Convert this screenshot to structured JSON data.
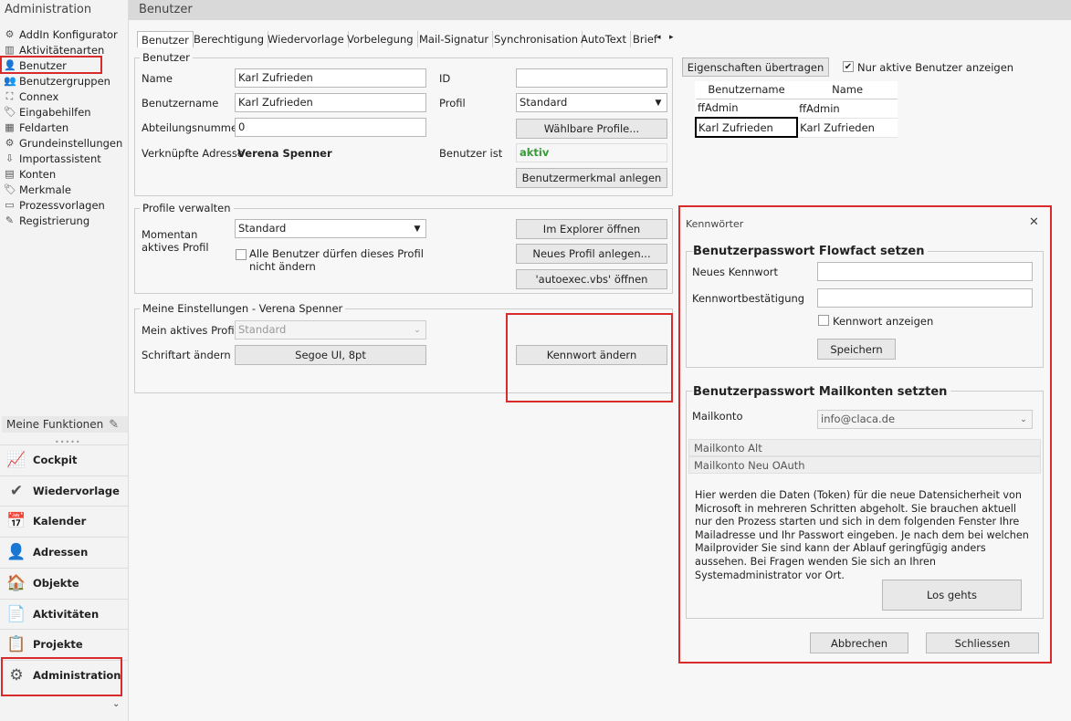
{
  "sidebar": {
    "title": "Administration",
    "tree": [
      {
        "label": "AddIn Konfigurator",
        "icon": "gears-icon"
      },
      {
        "label": "Aktivitätenarten",
        "icon": "chart-icon"
      },
      {
        "label": "Benutzer",
        "icon": "user-icon"
      },
      {
        "label": "Benutzergruppen",
        "icon": "users-icon"
      },
      {
        "label": "Connex",
        "icon": "connex-icon"
      },
      {
        "label": "Eingabehilfen",
        "icon": "tag-icon"
      },
      {
        "label": "Feldarten",
        "icon": "fields-icon"
      },
      {
        "label": "Grundeinstellungen",
        "icon": "settings-icon"
      },
      {
        "label": "Importassistent",
        "icon": "import-icon"
      },
      {
        "label": "Konten",
        "icon": "accounts-icon"
      },
      {
        "label": "Merkmale",
        "icon": "tag-outline-icon"
      },
      {
        "label": "Prozessvorlagen",
        "icon": "process-icon"
      },
      {
        "label": "Registrierung",
        "icon": "registration-icon"
      }
    ],
    "functions_label": "Meine Funktionen",
    "nav": [
      {
        "label": "Cockpit",
        "icon": "cockpit-icon",
        "glyph": "📈"
      },
      {
        "label": "Wiedervorlage",
        "icon": "checkmark-icon",
        "glyph": "✔"
      },
      {
        "label": "Kalender",
        "icon": "calendar-icon",
        "glyph": "📅"
      },
      {
        "label": "Adressen",
        "icon": "person-icon",
        "glyph": "👤"
      },
      {
        "label": "Objekte",
        "icon": "house-icon",
        "glyph": "🏠"
      },
      {
        "label": "Aktivitäten",
        "icon": "activities-icon",
        "glyph": "📄"
      },
      {
        "label": "Projekte",
        "icon": "projects-icon",
        "glyph": "📋"
      },
      {
        "label": "Administration",
        "icon": "admin-gear-icon",
        "glyph": "⚙"
      }
    ]
  },
  "header": {
    "title": "Benutzer"
  },
  "tabs": [
    "Benutzer",
    "Berechtigung",
    "Wiedervorlage",
    "Vorbelegung",
    "Mail-Signatur",
    "Synchronisation",
    "AutoText",
    "Brief"
  ],
  "benutzer_group": {
    "label": "Benutzer",
    "name_label": "Name",
    "name_value": "Karl Zufrieden",
    "username_label": "Benutzername",
    "username_value": "Karl Zufrieden",
    "dept_label": "Abteilungsnummer",
    "dept_value": "0",
    "addr_label": "Verknüpfte Adresse",
    "addr_value": "Verena Spenner",
    "id_label": "ID",
    "id_value": "",
    "profile_label": "Profil",
    "profile_value": "Standard",
    "profiles_btn": "Wählbare Profile...",
    "status_label": "Benutzer ist",
    "status_value": "aktiv",
    "feature_btn": "Benutzermerkmal anlegen"
  },
  "profile_group": {
    "label": "Profile verwalten",
    "current_label_1": "Momentan",
    "current_label_2": "aktives Profil",
    "current_value": "Standard",
    "lock_label_1": "Alle Benutzer dürfen dieses Profil",
    "lock_label_2": "nicht ändern",
    "explorer_btn": "Im Explorer öffnen",
    "new_btn": "Neues Profil anlegen...",
    "autoexec_btn": "'autoexec.vbs' öffnen"
  },
  "settings_group": {
    "label": "Meine Einstellungen - Verena Spenner",
    "profile_label": "Mein aktives Profil",
    "profile_value": "Standard",
    "font_label": "Schriftart ändern",
    "font_value": "Segoe UI, 8pt",
    "password_btn": "Kennwort ändern"
  },
  "right_panel": {
    "transfer_btn": "Eigenschaften übertragen",
    "active_only_label": "Nur aktive Benutzer anzeigen",
    "columns": [
      "Benutzername",
      "Name"
    ],
    "rows": [
      [
        "ffAdmin",
        "ffAdmin"
      ],
      [
        "Karl Zufrieden",
        "Karl Zufrieden"
      ]
    ]
  },
  "dialog": {
    "title": "Kennwörter",
    "close": "✕",
    "section1": "Benutzerpasswort Flowfact setzen",
    "new_pw_label": "Neues Kennwort",
    "confirm_pw_label": "Kennwortbestätigung",
    "show_pw_label": "Kennwort anzeigen",
    "save_btn": "Speichern",
    "section2": "Benutzerpasswort Mailkonten setzten",
    "mail_label": "Mailkonto",
    "mail_value": "info@claca.de",
    "accord1": "Mailkonto Alt",
    "accord2": "Mailkonto Neu OAuth",
    "info_text": "Hier werden die Daten (Token) für die neue Datensicherheit von Microsoft in mehreren Schritten abgeholt. Sie brauchen aktuell nur den Prozess starten und sich in dem folgenden Fenster Ihre Mailadresse und Ihr Passwort eingeben. Je nach dem bei welchen Mailprovider Sie sind kann der Ablauf geringfügig anders aussehen. Bei Fragen wenden Sie sich an Ihren Systemadministrator vor Ort.",
    "go_btn": "Los gehts",
    "cancel_btn": "Abbrechen",
    "close_btn": "Schliessen"
  }
}
